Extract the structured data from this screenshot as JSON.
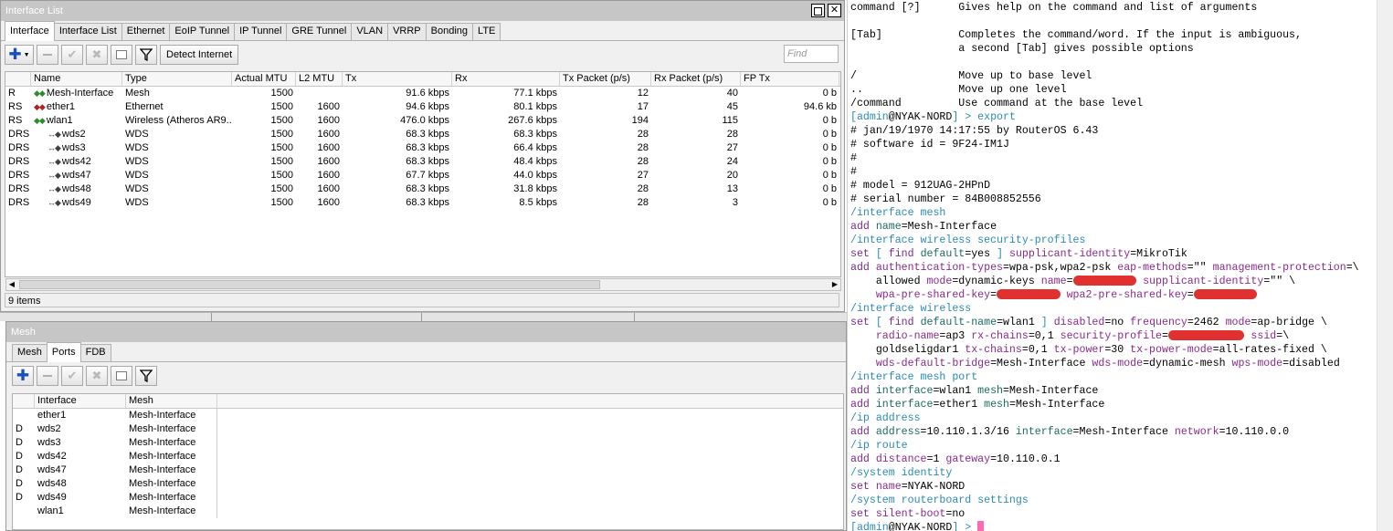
{
  "interface_window": {
    "title": "Interface List",
    "tabs": [
      "Interface",
      "Interface List",
      "Ethernet",
      "EoIP Tunnel",
      "IP Tunnel",
      "GRE Tunnel",
      "VLAN",
      "VRRP",
      "Bonding",
      "LTE"
    ],
    "active_tab": 0,
    "detect_internet_label": "Detect Internet",
    "find_placeholder": "Find",
    "columns": [
      "",
      "Name",
      "Type",
      "Actual MTU",
      "L2 MTU",
      "Tx",
      "Rx",
      "Tx Packet (p/s)",
      "Rx Packet (p/s)",
      "FP Tx"
    ],
    "rows": [
      {
        "flags": "R",
        "icon": "mesh-icon",
        "name": "Mesh-Interface",
        "type": "Mesh",
        "mtu": "1500",
        "l2mtu": "",
        "tx": "91.6 kbps",
        "rx": "77.1 kbps",
        "txp": "12",
        "rxp": "40",
        "fptx": "0 b"
      },
      {
        "flags": "RS",
        "icon": "ethernet-icon",
        "name": "ether1",
        "type": "Ethernet",
        "mtu": "1500",
        "l2mtu": "1600",
        "tx": "94.6 kbps",
        "rx": "80.1 kbps",
        "txp": "17",
        "rxp": "45",
        "fptx": "94.6 kb"
      },
      {
        "flags": "RS",
        "icon": "wireless-icon",
        "name": "wlan1",
        "type": "Wireless (Atheros AR9...",
        "mtu": "1500",
        "l2mtu": "1600",
        "tx": "476.0 kbps",
        "rx": "267.6 kbps",
        "txp": "194",
        "rxp": "115",
        "fptx": "0 b"
      },
      {
        "flags": "DRS",
        "icon": "wds-icon",
        "name": "wds2",
        "type": "WDS",
        "mtu": "1500",
        "l2mtu": "1600",
        "tx": "68.3 kbps",
        "rx": "68.3 kbps",
        "txp": "28",
        "rxp": "28",
        "fptx": "0 b"
      },
      {
        "flags": "DRS",
        "icon": "wds-icon",
        "name": "wds3",
        "type": "WDS",
        "mtu": "1500",
        "l2mtu": "1600",
        "tx": "68.3 kbps",
        "rx": "66.4 kbps",
        "txp": "28",
        "rxp": "27",
        "fptx": "0 b"
      },
      {
        "flags": "DRS",
        "icon": "wds-icon",
        "name": "wds42",
        "type": "WDS",
        "mtu": "1500",
        "l2mtu": "1600",
        "tx": "68.3 kbps",
        "rx": "48.4 kbps",
        "txp": "28",
        "rxp": "24",
        "fptx": "0 b"
      },
      {
        "flags": "DRS",
        "icon": "wds-icon",
        "name": "wds47",
        "type": "WDS",
        "mtu": "1500",
        "l2mtu": "1600",
        "tx": "67.7 kbps",
        "rx": "44.0 kbps",
        "txp": "27",
        "rxp": "20",
        "fptx": "0 b"
      },
      {
        "flags": "DRS",
        "icon": "wds-icon",
        "name": "wds48",
        "type": "WDS",
        "mtu": "1500",
        "l2mtu": "1600",
        "tx": "68.3 kbps",
        "rx": "31.8 kbps",
        "txp": "28",
        "rxp": "13",
        "fptx": "0 b"
      },
      {
        "flags": "DRS",
        "icon": "wds-icon",
        "name": "wds49",
        "type": "WDS",
        "mtu": "1500",
        "l2mtu": "1600",
        "tx": "68.3 kbps",
        "rx": "8.5 kbps",
        "txp": "28",
        "rxp": "3",
        "fptx": "0 b"
      }
    ],
    "status": "9 items"
  },
  "mesh_window": {
    "title": "Mesh",
    "tabs": [
      "Mesh",
      "Ports",
      "FDB"
    ],
    "active_tab": 1,
    "columns": [
      "",
      "Interface",
      "Mesh"
    ],
    "rows": [
      {
        "flags": "",
        "interface": "ether1",
        "mesh": "Mesh-Interface"
      },
      {
        "flags": "D",
        "interface": "wds2",
        "mesh": "Mesh-Interface"
      },
      {
        "flags": "D",
        "interface": "wds3",
        "mesh": "Mesh-Interface"
      },
      {
        "flags": "D",
        "interface": "wds42",
        "mesh": "Mesh-Interface"
      },
      {
        "flags": "D",
        "interface": "wds47",
        "mesh": "Mesh-Interface"
      },
      {
        "flags": "D",
        "interface": "wds48",
        "mesh": "Mesh-Interface"
      },
      {
        "flags": "D",
        "interface": "wds49",
        "mesh": "Mesh-Interface"
      },
      {
        "flags": "",
        "interface": "wlan1",
        "mesh": "Mesh-Interface"
      }
    ]
  },
  "terminal": {
    "prompt_user": "admin",
    "prompt_host": "NYAK-NORD",
    "lines": [
      {
        "segments": [
          [
            "dark",
            "command [?]      Gives help on the command and list of arguments"
          ]
        ]
      },
      {
        "segments": [
          [
            "dark",
            ""
          ]
        ]
      },
      {
        "segments": [
          [
            "dark",
            "[Tab]            Completes the command/word. If the input is ambiguous,"
          ]
        ]
      },
      {
        "segments": [
          [
            "dark",
            "                 a second [Tab] gives possible options"
          ]
        ]
      },
      {
        "segments": [
          [
            "dark",
            ""
          ]
        ]
      },
      {
        "segments": [
          [
            "dark",
            "/                Move up to base level"
          ]
        ]
      },
      {
        "segments": [
          [
            "dark",
            "..               Move up one level"
          ]
        ]
      },
      {
        "segments": [
          [
            "dark",
            "/command         Use command at the base level"
          ]
        ]
      },
      {
        "segments": [
          [
            "path",
            "[admin"
          ],
          [
            "dark",
            "@NYAK-NORD"
          ],
          [
            "path",
            "] > export"
          ]
        ]
      },
      {
        "segments": [
          [
            "cmt",
            "# jan/19/1970 14:17:55 by RouterOS 6.43"
          ]
        ]
      },
      {
        "segments": [
          [
            "cmt",
            "# software id = 9F24-IM1J"
          ]
        ]
      },
      {
        "segments": [
          [
            "cmt",
            "#"
          ]
        ]
      },
      {
        "segments": [
          [
            "cmt",
            "#"
          ]
        ]
      },
      {
        "segments": [
          [
            "cmt",
            "# model = 912UAG-2HPnD"
          ]
        ]
      },
      {
        "segments": [
          [
            "cmt",
            "# serial number = 84B008852556"
          ]
        ]
      },
      {
        "segments": [
          [
            "path",
            "/interface mesh"
          ]
        ]
      },
      {
        "segments": [
          [
            "verb",
            "add "
          ],
          [
            "key",
            "name"
          ],
          [
            "dark",
            "=Mesh-Interface"
          ]
        ]
      },
      {
        "segments": [
          [
            "path",
            "/interface wireless security-profiles"
          ]
        ]
      },
      {
        "segments": [
          [
            "verb",
            "set "
          ],
          [
            "path",
            "[ "
          ],
          [
            "verb",
            "find "
          ],
          [
            "key",
            "default"
          ],
          [
            "dark",
            "=yes "
          ],
          [
            "path",
            "] "
          ],
          [
            "prm",
            "supplicant-identity"
          ],
          [
            "dark",
            "=MikroTik"
          ]
        ]
      },
      {
        "segments": [
          [
            "verb",
            "add "
          ],
          [
            "prm",
            "authentication-types"
          ],
          [
            "dark",
            "=wpa-psk,wpa2-psk "
          ],
          [
            "prm",
            "eap-methods"
          ],
          [
            "dark",
            "=\"\" "
          ],
          [
            "prm",
            "management-protection"
          ],
          [
            "dark",
            "=\\"
          ]
        ]
      },
      {
        "segments": [
          [
            "dark",
            "    allowed "
          ],
          [
            "prm",
            "mode"
          ],
          [
            "dark",
            "=dynamic-keys "
          ],
          [
            "prm",
            "name"
          ],
          [
            "dark",
            "="
          ],
          [
            "redact",
            "          "
          ],
          [
            "dark",
            " "
          ],
          [
            "prm",
            "supplicant-identity"
          ],
          [
            "dark",
            "=\"\" \\"
          ]
        ]
      },
      {
        "segments": [
          [
            "dark",
            "    "
          ],
          [
            "prm",
            "wpa-pre-shared-key"
          ],
          [
            "dark",
            "="
          ],
          [
            "redact",
            "          "
          ],
          [
            "dark",
            " "
          ],
          [
            "prm",
            "wpa2-pre-shared-key"
          ],
          [
            "dark",
            "="
          ],
          [
            "redact",
            "          "
          ]
        ]
      },
      {
        "segments": [
          [
            "path",
            "/interface wireless"
          ]
        ]
      },
      {
        "segments": [
          [
            "verb",
            "set "
          ],
          [
            "path",
            "[ "
          ],
          [
            "verb",
            "find "
          ],
          [
            "key",
            "default-name"
          ],
          [
            "dark",
            "=wlan1 "
          ],
          [
            "path",
            "] "
          ],
          [
            "prm",
            "disabled"
          ],
          [
            "dark",
            "=no "
          ],
          [
            "prm",
            "frequency"
          ],
          [
            "dark",
            "=2462 "
          ],
          [
            "prm",
            "mode"
          ],
          [
            "dark",
            "=ap-bridge \\"
          ]
        ]
      },
      {
        "segments": [
          [
            "dark",
            "    "
          ],
          [
            "prm",
            "radio-name"
          ],
          [
            "dark",
            "=ap3 "
          ],
          [
            "prm",
            "rx-chains"
          ],
          [
            "dark",
            "=0,1 "
          ],
          [
            "prm",
            "security-profile"
          ],
          [
            "dark",
            "="
          ],
          [
            "redact",
            "            "
          ],
          [
            "dark",
            " "
          ],
          [
            "prm",
            "ssid"
          ],
          [
            "dark",
            "=\\"
          ]
        ]
      },
      {
        "segments": [
          [
            "dark",
            "    goldseligdar1 "
          ],
          [
            "prm",
            "tx-chains"
          ],
          [
            "dark",
            "=0,1 "
          ],
          [
            "prm",
            "tx-power"
          ],
          [
            "dark",
            "=30 "
          ],
          [
            "prm",
            "tx-power-mode"
          ],
          [
            "dark",
            "=all-rates-fixed \\"
          ]
        ]
      },
      {
        "segments": [
          [
            "dark",
            "    "
          ],
          [
            "prm",
            "wds-default-bridge"
          ],
          [
            "dark",
            "=Mesh-Interface "
          ],
          [
            "prm",
            "wds-mode"
          ],
          [
            "dark",
            "=dynamic-mesh "
          ],
          [
            "prm",
            "wps-mode"
          ],
          [
            "dark",
            "=disabled"
          ]
        ]
      },
      {
        "segments": [
          [
            "path",
            "/interface mesh port"
          ]
        ]
      },
      {
        "segments": [
          [
            "verb",
            "add "
          ],
          [
            "key",
            "interface"
          ],
          [
            "dark",
            "=wlan1 "
          ],
          [
            "key",
            "mesh"
          ],
          [
            "dark",
            "=Mesh-Interface"
          ]
        ]
      },
      {
        "segments": [
          [
            "verb",
            "add "
          ],
          [
            "key",
            "interface"
          ],
          [
            "dark",
            "=ether1 "
          ],
          [
            "key",
            "mesh"
          ],
          [
            "dark",
            "=Mesh-Interface"
          ]
        ]
      },
      {
        "segments": [
          [
            "path",
            "/ip address"
          ]
        ]
      },
      {
        "segments": [
          [
            "verb",
            "add "
          ],
          [
            "key",
            "address"
          ],
          [
            "dark",
            "=10.110.1.3/16 "
          ],
          [
            "key",
            "interface"
          ],
          [
            "dark",
            "=Mesh-Interface "
          ],
          [
            "prm",
            "network"
          ],
          [
            "dark",
            "=10.110.0.0"
          ]
        ]
      },
      {
        "segments": [
          [
            "path",
            "/ip route"
          ]
        ]
      },
      {
        "segments": [
          [
            "verb",
            "add "
          ],
          [
            "prm",
            "distance"
          ],
          [
            "dark",
            "=1 "
          ],
          [
            "prm",
            "gateway"
          ],
          [
            "dark",
            "=10.110.0.1"
          ]
        ]
      },
      {
        "segments": [
          [
            "path",
            "/system identity"
          ]
        ]
      },
      {
        "segments": [
          [
            "verb",
            "set "
          ],
          [
            "prm",
            "name"
          ],
          [
            "dark",
            "=NYAK-NORD"
          ]
        ]
      },
      {
        "segments": [
          [
            "path",
            "/system routerboard settings"
          ]
        ]
      },
      {
        "segments": [
          [
            "verb",
            "set "
          ],
          [
            "prm",
            "silent-boot"
          ],
          [
            "dark",
            "=no"
          ]
        ]
      }
    ],
    "final_prompt_suffix": "] > "
  },
  "colors": {
    "title_bar": "#c6c6c6",
    "terminal_path": "#2d8ab5",
    "terminal_verb": "#7a2b8a",
    "cursor": "#ff69b4",
    "redaction": "#e03030"
  }
}
